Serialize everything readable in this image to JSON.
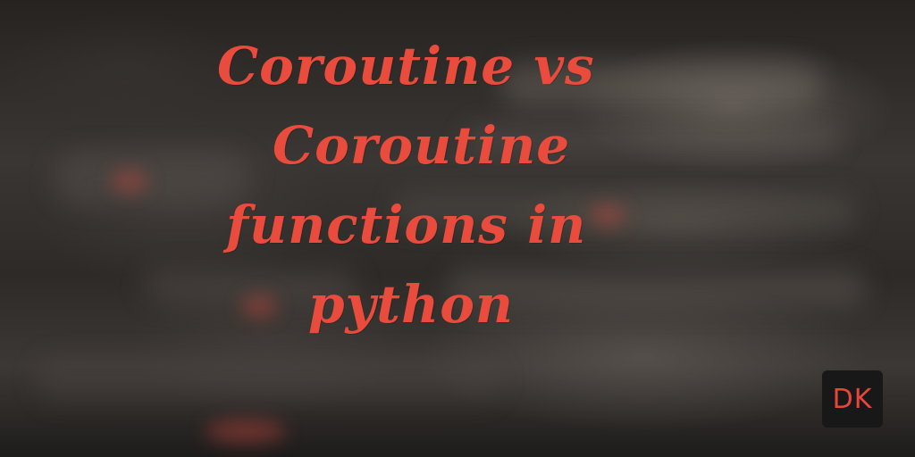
{
  "title_lines": [
    "Coroutine vs",
    "Coroutine",
    "functions in",
    "python"
  ],
  "logo": {
    "text": "DK"
  },
  "colors": {
    "title": "#e94b3c",
    "logo_text": "#e8463a",
    "logo_background": "#191818",
    "background": "#2f2b29"
  }
}
